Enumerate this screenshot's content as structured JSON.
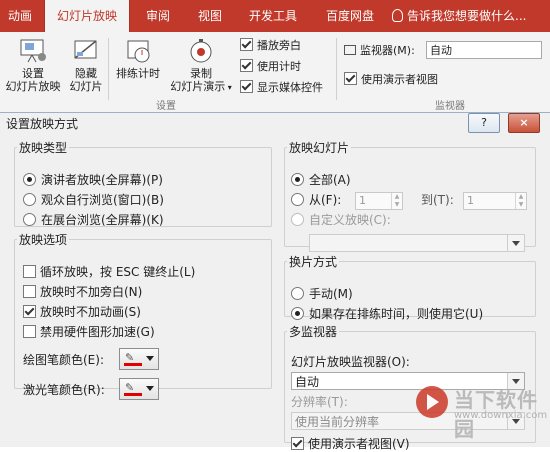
{
  "ribbon": {
    "tabs": [
      "动画",
      "幻灯片放映",
      "审阅",
      "视图",
      "开发工具",
      "百度网盘"
    ],
    "active_tab": "幻灯片放映",
    "tell_me": "告诉我您想要做什么...",
    "buttons": {
      "setup_show_line1": "设置",
      "setup_show_line2": "幻灯片放映",
      "hide_slide_line1": "隐藏",
      "hide_slide_line2": "幻灯片",
      "rehearse": "排练计时",
      "record_line1": "录制",
      "record_line2": "幻灯片演示"
    },
    "checks": {
      "play_narrations": "播放旁白",
      "use_timings": "使用计时",
      "show_media_controls": "显示媒体控件",
      "use_presenter_view": "使用演示者视图"
    },
    "group_setup_label": "设置",
    "group_monitors_label": "监视器",
    "monitor_label": "监视器(M):",
    "monitor_value": "自动"
  },
  "dialog": {
    "title": "设置放映方式",
    "help_button": "?",
    "close_button": "×",
    "show_type": {
      "legend": "放映类型",
      "options": [
        "演讲者放映(全屏幕)(P)",
        "观众自行浏览(窗口)(B)",
        "在展台浏览(全屏幕)(K)"
      ],
      "selected": 0
    },
    "show_options": {
      "legend": "放映选项",
      "items": [
        {
          "label": "循环放映，按 ESC 键终止(L)",
          "checked": false
        },
        {
          "label": "放映时不加旁白(N)",
          "checked": false
        },
        {
          "label": "放映时不加动画(S)",
          "checked": true
        },
        {
          "label": "禁用硬件图形加速(G)",
          "checked": false
        }
      ],
      "pen_color_label": "绘图笔颜色(E):",
      "laser_color_label": "激光笔颜色(R):"
    },
    "show_slides": {
      "legend": "放映幻灯片",
      "all_label": "全部(A)",
      "from_label": "从(F):",
      "from_value": "1",
      "to_label": "到(T):",
      "to_value": "1",
      "custom_label": "自定义放映(C):"
    },
    "advance": {
      "legend": "换片方式",
      "manual": "手动(M)",
      "timings": "如果存在排练时间，则使用它(U)",
      "selected": 1
    },
    "monitors": {
      "legend": "多监视器",
      "monitor_label": "幻灯片放映监视器(O):",
      "monitor_value": "自动",
      "resolution_label": "分辨率(T):",
      "resolution_value": "使用当前分辨率",
      "presenter_view_label": "使用演示者视图(V)",
      "presenter_view_checked": true
    }
  },
  "watermark": {
    "line1": "当下软件园",
    "line2": "www.downxia.com"
  },
  "colors": {
    "ribbon_red": "#c0392b",
    "pen_color": "#e00000"
  }
}
